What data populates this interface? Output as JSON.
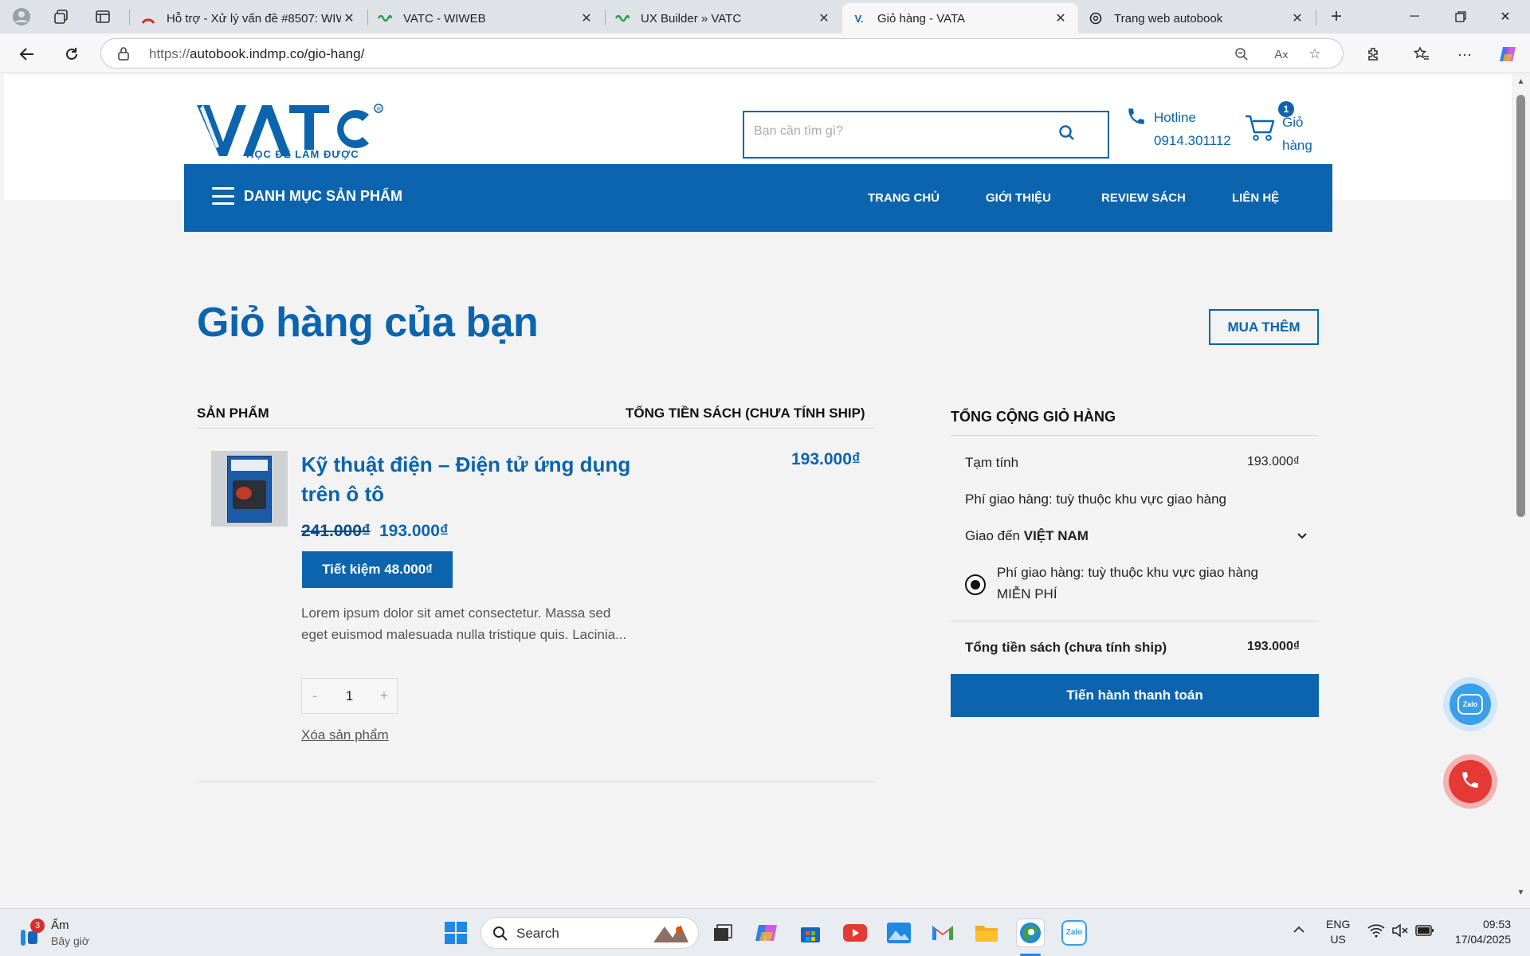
{
  "browser": {
    "tabs": [
      {
        "title": "Hỗ trợ - Xử lý vấn đề #8507: WIW",
        "active": false
      },
      {
        "title": "VATC - WIWEB",
        "active": false
      },
      {
        "title": "UX Builder » VATC",
        "active": false
      },
      {
        "title": "Giỏ hàng - VATA",
        "active": true
      },
      {
        "title": "Trang web autobook",
        "active": false
      }
    ],
    "url_scheme": "https://",
    "url_rest": "autobook.indmp.co/gio-hang/"
  },
  "header": {
    "logo_text": "VATC",
    "logo_tagline": "HỌC ĐỂ LÀM ĐƯỢC",
    "search_placeholder": "Bạn cần tìm gì?",
    "hotline_label": "Hotline",
    "hotline_number": "0914.301112",
    "cart_label": "Giỏ hàng",
    "cart_count": "1"
  },
  "nav": {
    "category_label": "DANH MỤC SẢN PHẨM",
    "items": [
      "TRANG CHỦ",
      "GIỚI THIỆU",
      "REVIEW SÁCH",
      "LIÊN HỆ"
    ]
  },
  "cart_page": {
    "title": "Giỏ hàng của bạn",
    "buy_more": "MUA THÊM",
    "col_product": "SẢN PHẨM",
    "col_total": "TỔNG TIỀN SÁCH (CHƯA TÍNH SHIP)",
    "item": {
      "name": "Kỹ thuật điện – Điện tử ứng dụng trên ô tô",
      "old_price": "241.000₫",
      "new_price": "193.000₫",
      "save_label": "Tiết kiệm 48.000₫",
      "description": "Lorem ipsum dolor sit amet consectetur. Massa sed eget euismod malesuada nulla tristique quis. Lacinia...",
      "quantity": "1",
      "qty_minus": "-",
      "qty_plus": "+",
      "remove_label": "Xóa sản phẩm",
      "line_total": "193.000₫"
    },
    "summary": {
      "heading": "TỔNG CỘNG GIỎ HÀNG",
      "subtotal_label": "Tạm tính",
      "subtotal_value": "193.000₫",
      "shipping_note": "Phí giao hàng: tuỳ thuộc khu vực giao hàng",
      "ship_to_prefix": "Giao đến",
      "ship_to_country": "VIỆT NAM",
      "shipping_option": "Phí giao hàng: tuỳ thuộc khu vực giao hàng",
      "shipping_option_value": "MIỄN PHÍ",
      "total_label": "Tổng tiền sách (chưa tính ship)",
      "total_value": "193.000₫",
      "checkout_label": "Tiến hành thanh toán"
    }
  },
  "floating": {
    "zalo_label": "Zalo"
  },
  "taskbar": {
    "weather_label": "Ấm",
    "weather_sub": "Bây giờ",
    "weather_badge": "3",
    "search_label": "Search",
    "lang_top": "ENG",
    "lang_bottom": "US",
    "time": "09:53",
    "date": "17/04/2025"
  },
  "colors": {
    "brand": "#0b64ad",
    "call": "#e53935",
    "zalo": "#3a9ee8"
  }
}
